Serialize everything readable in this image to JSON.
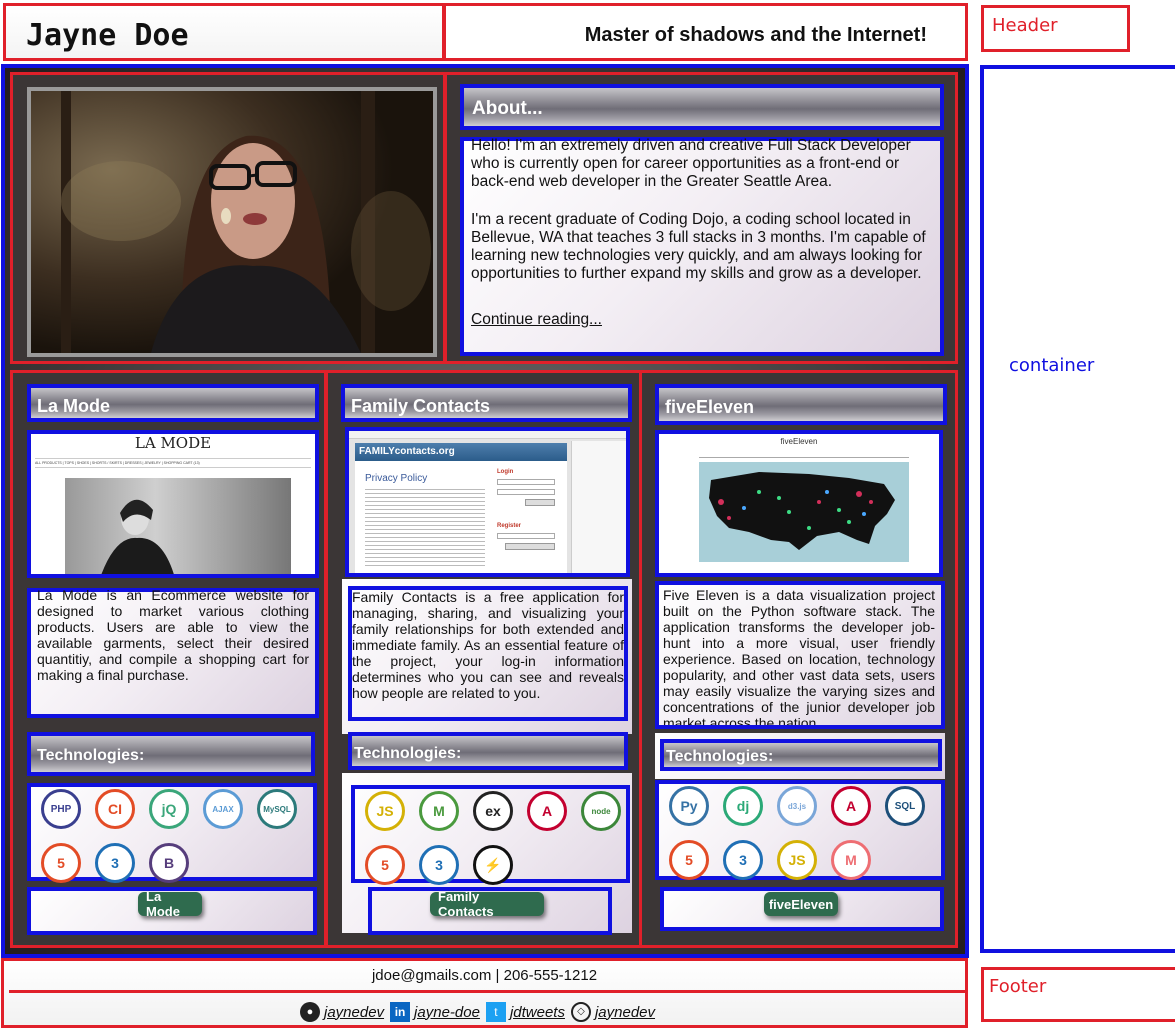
{
  "header": {
    "name": "Jayne Doe",
    "tagline": "Master of shadows and the Internet!",
    "note_label": "Header"
  },
  "container_label": "container",
  "footer_label": "Footer",
  "about": {
    "heading": "About...",
    "para1": "Hello! I'm an extremely driven and creative Full Stack Developer who is currently open for career opportunities as a front-end or back-end web developer in the Greater Seattle Area.",
    "para2": "I'm a recent graduate of Coding Dojo, a coding school located in Bellevue, WA that teaches 3 full stacks in 3 months. I'm capable of learning new technologies very quickly, and am always looking for opportunities to further expand my skills and grow as a developer.",
    "link": "Continue reading..."
  },
  "projects": [
    {
      "title": "La Mode",
      "description": "La Mode is an Ecommerce website for designed to market various clothing products. Users are able to view the available garments, select their desired quantitiy, and compile a shopping cart for making a final purchase.",
      "tech_heading": "Technologies:",
      "button": "La Mode",
      "screenshot_title": "LA MODE",
      "screenshot_nav": "ALL PRODUCTS | TOPS | SHOES | SHORTS / SKIRTS | DRESSES | JEWELRY | SHOPPING CART (13)",
      "icons": [
        {
          "name": "php-icon",
          "glyph": "PHP",
          "color": "#3a3f8f"
        },
        {
          "name": "codeigniter-icon",
          "glyph": "CI",
          "color": "#e34c26"
        },
        {
          "name": "jquery-icon",
          "glyph": "jQ",
          "color": "#3aa67a"
        },
        {
          "name": "ajax-icon",
          "glyph": "AJAX",
          "color": "#5b9bd5"
        },
        {
          "name": "mysql-icon",
          "glyph": "MySQL",
          "color": "#2c7a7b"
        },
        {
          "name": "html5-icon",
          "glyph": "5",
          "color": "#e34c26"
        },
        {
          "name": "css3-icon",
          "glyph": "3",
          "color": "#1f6fb5"
        },
        {
          "name": "bootstrap-icon",
          "glyph": "B",
          "color": "#563d7c"
        }
      ]
    },
    {
      "title": "Family Contacts",
      "description": "Family Contacts is a free application for managing, sharing, and visualizing your family relationships for both extended and immediate family. As an essential feature of the project, your log-in information determines who you can see and reveals how people are related to you.",
      "tech_heading": "Technologies:",
      "button": "Family Contacts",
      "screenshot_title": "FAMILYcontacts.org",
      "screenshot_heading": "Privacy Policy",
      "screenshot_login": "Login",
      "screenshot_register": "Register",
      "icons": [
        {
          "name": "javascript-icon",
          "glyph": "JS",
          "color": "#d4b106"
        },
        {
          "name": "mongodb-icon",
          "glyph": "M",
          "color": "#4a9a3e"
        },
        {
          "name": "express-icon",
          "glyph": "ex",
          "color": "#222222"
        },
        {
          "name": "angular-icon",
          "glyph": "A",
          "color": "#c3002f"
        },
        {
          "name": "nodejs-icon",
          "glyph": "node",
          "color": "#3c873a"
        },
        {
          "name": "html5-icon",
          "glyph": "5",
          "color": "#e34c26"
        },
        {
          "name": "css3-icon",
          "glyph": "3",
          "color": "#1f6fb5"
        },
        {
          "name": "socketio-icon",
          "glyph": "⚡",
          "color": "#111111"
        }
      ]
    },
    {
      "title": "fiveEleven",
      "description": "Five Eleven is a data visualization project built on the Python software stack. The application transforms the developer job-hunt into a more visual, user friendly experience. Based on location, technology popularity, and other vast data sets, users may easily visualize the varying sizes and concentrations of the junior developer job market across the nation.",
      "tech_heading": "Technologies:",
      "button": "fiveEleven",
      "screenshot_title": "fiveEleven",
      "icons": [
        {
          "name": "python-icon",
          "glyph": "Py",
          "color": "#3572a5"
        },
        {
          "name": "django-icon",
          "glyph": "dj",
          "color": "#2ba977"
        },
        {
          "name": "d3js-icon",
          "glyph": "d3.js",
          "color": "#7aa6d8"
        },
        {
          "name": "angular-icon",
          "glyph": "A",
          "color": "#c3002f"
        },
        {
          "name": "sqlite-icon",
          "glyph": "SQL",
          "color": "#1d4f7a"
        },
        {
          "name": "html5-icon",
          "glyph": "5",
          "color": "#e34c26"
        },
        {
          "name": "css3-icon",
          "glyph": "3",
          "color": "#1f6fb5"
        },
        {
          "name": "javascript-icon",
          "glyph": "JS",
          "color": "#d4b106"
        },
        {
          "name": "materialize-icon",
          "glyph": "M",
          "color": "#ee6e73"
        }
      ]
    }
  ],
  "footer": {
    "contact": "jdoe@gmails.com | 206-555-1212",
    "links": [
      {
        "icon": "github-icon",
        "label": "jaynedev"
      },
      {
        "icon": "linkedin-icon",
        "label": "jayne-doe"
      },
      {
        "icon": "twitter-icon",
        "label": "jdtweets"
      },
      {
        "icon": "codepen-icon",
        "label": "jaynedev"
      }
    ]
  }
}
